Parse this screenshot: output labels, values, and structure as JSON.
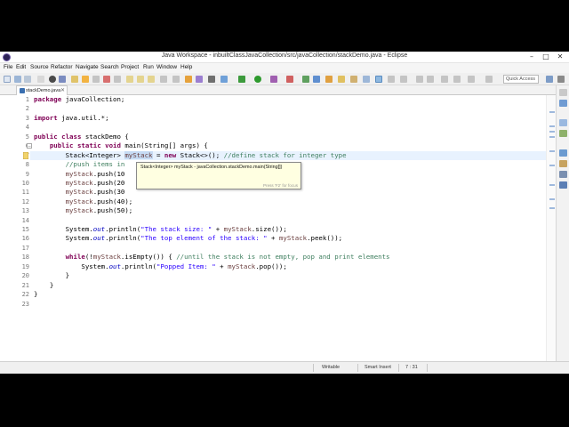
{
  "window": {
    "title": "Java Workspace - inbuiltClassJavaCollection/src/javaCollection/stackDemo.java - Eclipse",
    "minimize_glyph": "–",
    "maximize_glyph": "□",
    "close_glyph": "✕"
  },
  "menu": {
    "items": [
      "File",
      "Edit",
      "Source",
      "Refactor",
      "Navigate",
      "Search",
      "Project",
      "Run",
      "Window",
      "Help"
    ]
  },
  "toolbar": {
    "quick_access_placeholder": "Quick Access"
  },
  "editor_tab": {
    "label": "stackDemo.java",
    "close_glyph": "✕"
  },
  "editor": {
    "line_numbers": [
      "1",
      "2",
      "3",
      "4",
      "5",
      "6",
      "7",
      "8",
      "9",
      "10",
      "11",
      "12",
      "13",
      "14",
      "15",
      "16",
      "17",
      "18",
      "19",
      "20",
      "21",
      "22",
      "23"
    ],
    "fold_glyph": "−",
    "lines": {
      "l1": {
        "kw": "package",
        "rest": " javaCollection;"
      },
      "l3": {
        "kw": "import",
        "rest": " java.util.*;"
      },
      "l5": {
        "kw1": "public",
        "kw2": "class",
        "rest": " stackDemo {"
      },
      "l6": {
        "kw1": "public",
        "kw2": "static",
        "kw3": "void",
        "rest": " main(String[] args) {"
      },
      "l7": {
        "pre": "Stack<Integer> ",
        "var": "myStack",
        "mid": " = ",
        "kw": "new",
        "post": " Stack<>(); ",
        "cmt": "//define stack for integer type"
      },
      "l8": {
        "cmt": "//push items in"
      },
      "l9": {
        "var": "myStack",
        "rest": ".push(10"
      },
      "l10": {
        "var": "myStack",
        "rest": ".push(20"
      },
      "l11": {
        "var": "myStack",
        "rest": ".push(30"
      },
      "l12": {
        "var": "myStack",
        "rest": ".push(40);"
      },
      "l13": {
        "var": "myStack",
        "rest": ".push(50);"
      },
      "l15": {
        "pre": "System.",
        "out": "out",
        "mid": ".println(",
        "str": "\"The stack size: \"",
        "plus": " + ",
        "var": "myStack",
        "rest": ".size());"
      },
      "l16": {
        "pre": "System.",
        "out": "out",
        "mid": ".println(",
        "str": "\"The top element of the stack: \"",
        "plus": " + ",
        "var": "myStack",
        "rest": ".peek());"
      },
      "l18": {
        "kw": "while",
        "pre": "(!",
        "var": "myStack",
        "mid": ".isEmpty()) { ",
        "cmt": "//until the stack is not empty, pop and print elements"
      },
      "l19": {
        "pre": "System.",
        "out": "out",
        "mid": ".println(",
        "str": "\"Popped Item: \"",
        "plus": " + ",
        "var": "myStack",
        "rest": ".pop());"
      },
      "l20": {
        "text": "}"
      },
      "l21": {
        "text": "}"
      },
      "l22": {
        "text": "}"
      }
    }
  },
  "hover": {
    "signature": "Stack<Integer> myStack - javaCollection.stackDemo.main(String[])",
    "hint": "Press 'F2' for focus"
  },
  "status": {
    "writable": "Writable",
    "insert_mode": "Smart Insert",
    "position": "7 : 31"
  },
  "colors": {
    "keyword": "#7f0055",
    "string": "#2a00ff",
    "comment": "#3f7f5f",
    "variable": "#6a3e3e",
    "static_field": "#0000c0",
    "current_line": "#e8f2fe",
    "tooltip_bg": "#ffffe1"
  },
  "icons": {
    "app": "eclipse-icon",
    "run": "run-icon",
    "debug": "debug-icon",
    "search": "search-icon"
  }
}
